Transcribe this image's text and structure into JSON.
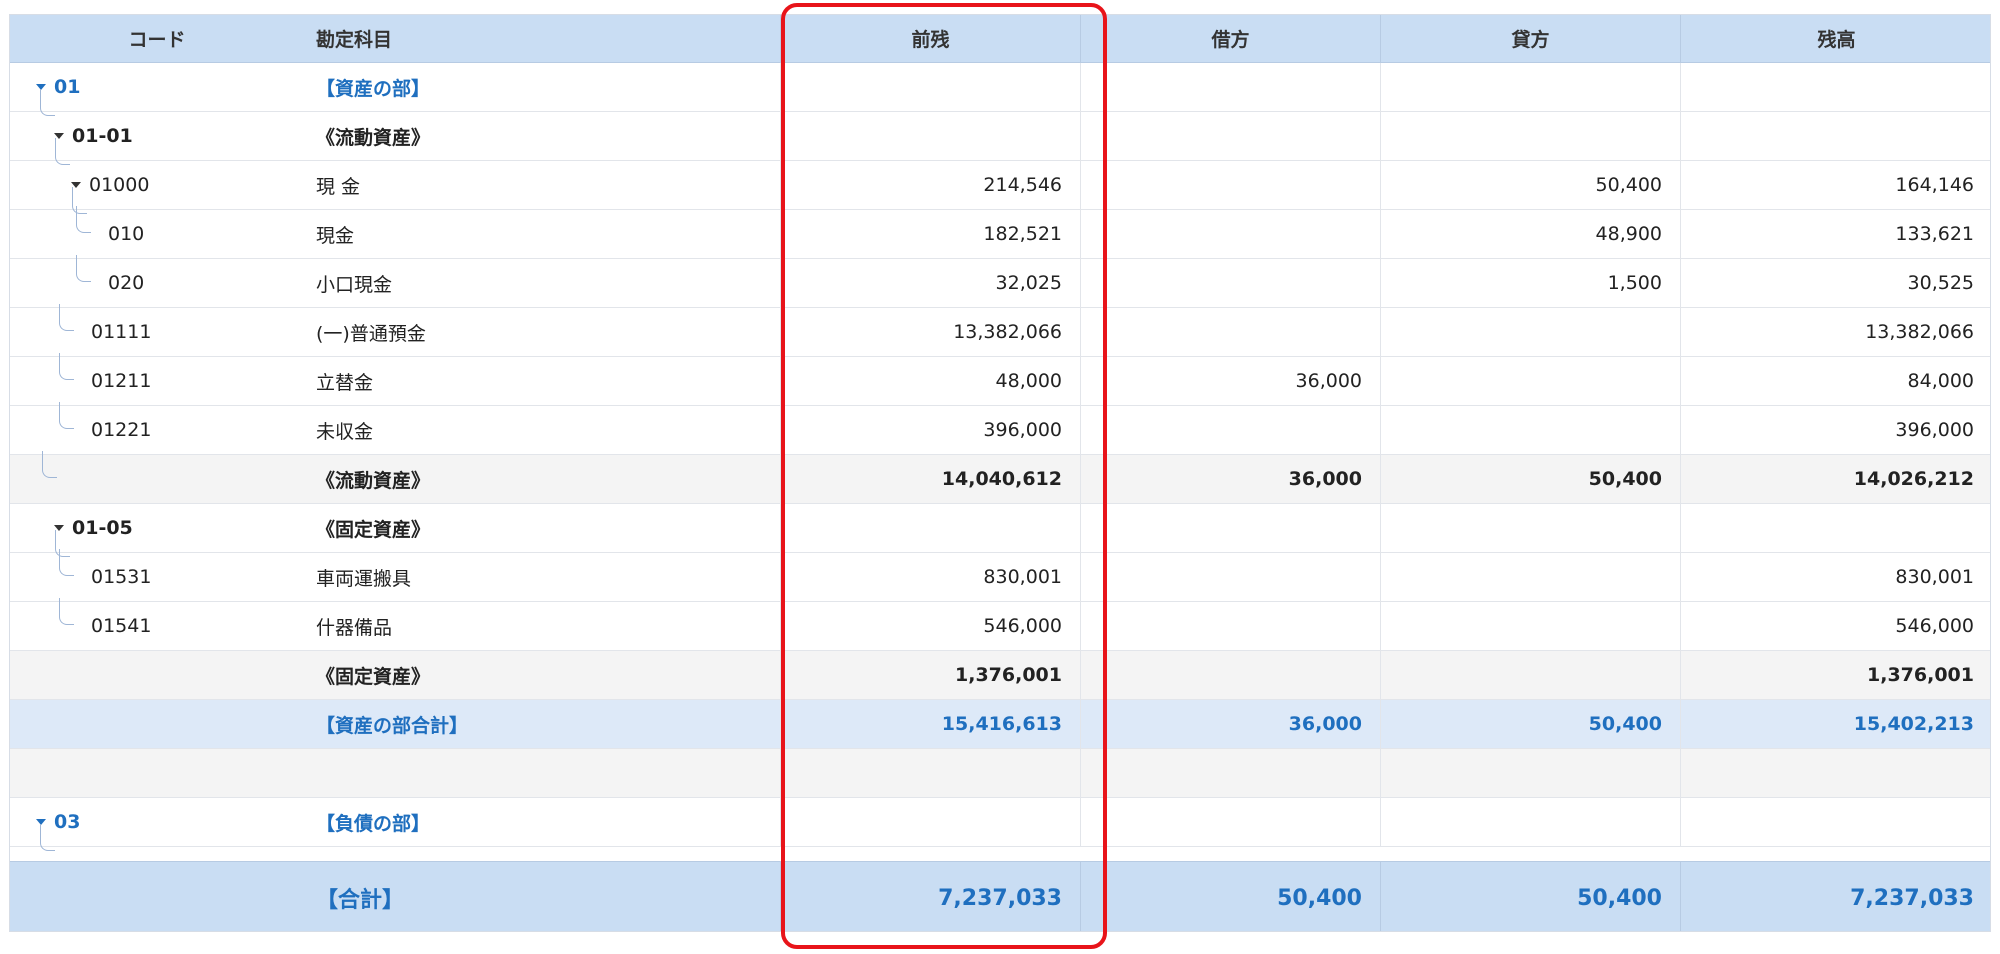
{
  "header": {
    "code": "コード",
    "name": "勘定科目",
    "prev": "前残",
    "debit": "借方",
    "credit": "貸方",
    "balance": "残高"
  },
  "rows": [
    {
      "code": "01",
      "name": "【資産の部】",
      "prev": "",
      "debit": "",
      "credit": "",
      "balance": ""
    },
    {
      "code": "01-01",
      "name": "《流動資産》",
      "prev": "",
      "debit": "",
      "credit": "",
      "balance": ""
    },
    {
      "code": "01000",
      "name": "現 金",
      "prev": "214,546",
      "debit": "",
      "credit": "50,400",
      "balance": "164,146"
    },
    {
      "code": "010",
      "name": "現金",
      "prev": "182,521",
      "debit": "",
      "credit": "48,900",
      "balance": "133,621"
    },
    {
      "code": "020",
      "name": "小口現金",
      "prev": "32,025",
      "debit": "",
      "credit": "1,500",
      "balance": "30,525"
    },
    {
      "code": "01111",
      "name": "(一)普通預金",
      "prev": "13,382,066",
      "debit": "",
      "credit": "",
      "balance": "13,382,066"
    },
    {
      "code": "01211",
      "name": "立替金",
      "prev": "48,000",
      "debit": "36,000",
      "credit": "",
      "balance": "84,000"
    },
    {
      "code": "01221",
      "name": "未収金",
      "prev": "396,000",
      "debit": "",
      "credit": "",
      "balance": "396,000"
    },
    {
      "code": "",
      "name": "《流動資産》",
      "prev": "14,040,612",
      "debit": "36,000",
      "credit": "50,400",
      "balance": "14,026,212"
    },
    {
      "code": "01-05",
      "name": "《固定資産》",
      "prev": "",
      "debit": "",
      "credit": "",
      "balance": ""
    },
    {
      "code": "01531",
      "name": "車両運搬具",
      "prev": "830,001",
      "debit": "",
      "credit": "",
      "balance": "830,001"
    },
    {
      "code": "01541",
      "name": "什器備品",
      "prev": "546,000",
      "debit": "",
      "credit": "",
      "balance": "546,000"
    },
    {
      "code": "",
      "name": "《固定資産》",
      "prev": "1,376,001",
      "debit": "",
      "credit": "",
      "balance": "1,376,001"
    },
    {
      "code": "",
      "name": "【資産の部合計】",
      "prev": "15,416,613",
      "debit": "36,000",
      "credit": "50,400",
      "balance": "15,402,213"
    },
    {
      "code": "",
      "name": "",
      "prev": "",
      "debit": "",
      "credit": "",
      "balance": ""
    },
    {
      "code": "03",
      "name": "【負債の部】",
      "prev": "",
      "debit": "",
      "credit": "",
      "balance": ""
    }
  ],
  "footer": {
    "name": "【合計】",
    "prev": "7,237,033",
    "debit": "50,400",
    "credit": "50,400",
    "balance": "7,237,033"
  },
  "colors": {
    "header_bg": "#c9ddf3",
    "accent_blue": "#1f6fbf",
    "highlight_red": "#e8141a"
  }
}
